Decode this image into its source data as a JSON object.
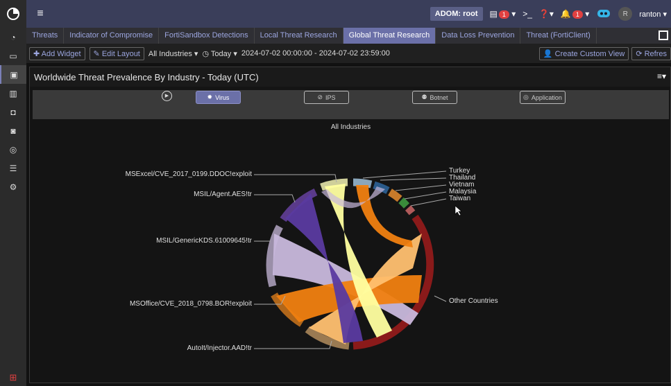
{
  "header": {
    "adom": "ADOM: root",
    "menu_badge": "1",
    "alert_badge": "1",
    "avatar_letter": "R",
    "user": "ranton"
  },
  "tabs": [
    "Threats",
    "Indicator of Compromise",
    "FortiSandbox Detections",
    "Local Threat Research",
    "Global Threat Research",
    "Data Loss Prevention",
    "Threat (FortiClient)"
  ],
  "toolbar": {
    "add_widget": "Add Widget",
    "edit_layout": "Edit Layout",
    "industry": "All Industries",
    "time": "Today",
    "range": "2024-07-02 00:00:00 - 2024-07-02 23:59:00",
    "create_view": "Create Custom View",
    "refresh": "Refres"
  },
  "widget": {
    "title": "Worldwide Threat Prevalence By Industry - Today (UTC)",
    "filters": [
      "Virus",
      "IPS",
      "Botnet",
      "Application"
    ],
    "subtitle": "All Industries",
    "threats": [
      "MSExcel/CVE_2017_0199.DDOC!exploit",
      "MSIL/Agent.AES!tr",
      "MSIL/GenericKDS.61009645!tr",
      "MSOffice/CVE_2018_0798.BOR!exploit",
      "AutoIt/Injector.AAD!tr"
    ],
    "countries": [
      "Turkey",
      "Thailand",
      "Vietnam",
      "Malaysia",
      "Taiwan",
      "Other Countries"
    ]
  }
}
